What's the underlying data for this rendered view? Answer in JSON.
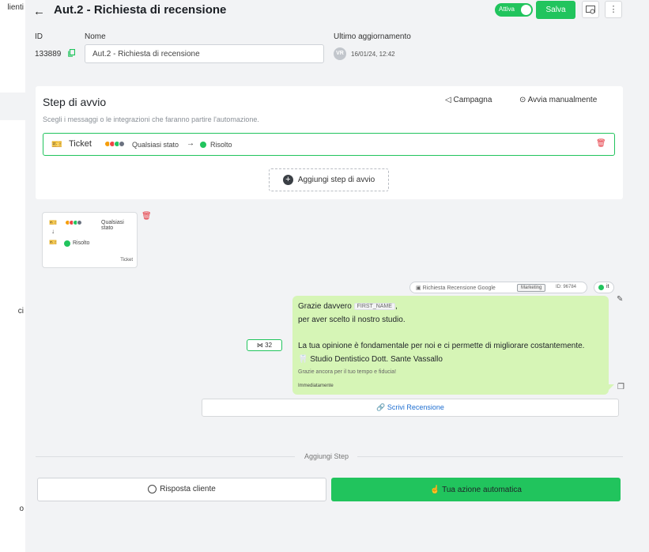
{
  "sidebar_fragments": [
    "lienti",
    "ci",
    "o"
  ],
  "header": {
    "back_icon": "arrow-left-icon",
    "title": "Aut.2 - Richiesta di recensione",
    "toggle_label": "Attiva",
    "toggle_on": true,
    "save_label": "Salva",
    "preview_icon": "preview-settings-icon",
    "more_icon": "more-vertical-icon"
  },
  "meta": {
    "id_label": "ID",
    "id_value": "133889",
    "name_label": "Nome",
    "name_value": "Aut.2 - Richiesta di recensione",
    "updated_label": "Ultimo aggiornamento",
    "updated_avatar": "VR",
    "updated_value": "16/01/24, 12:42"
  },
  "start_steps": {
    "title": "Step di avvio",
    "description": "Scegli i messaggi o le integrazioni che faranno partire l'automazione.",
    "campaign_label": "Campagna",
    "manual_label": "Avvia manualmente",
    "trigger": {
      "name": "Ticket",
      "from_state": "Qualsiasi stato",
      "arrow": "→",
      "to_state": "Risolto"
    },
    "add_label": "Aggiungi step di avvio"
  },
  "flow_node": {
    "from_state": "Qualsiasi stato",
    "to_state": "Risolto",
    "footer": "Ticket"
  },
  "template": {
    "name": "Richiesta Recensione Google",
    "category": "Marketing",
    "id_text": "ID: 96784",
    "language": "it"
  },
  "message": {
    "line1_prefix": "Grazie davvero",
    "variable": "FIRST_NAME",
    "line1_suffix": ",",
    "line2": "per aver scelto il nostro studio.",
    "line3": "La tua opinione è fondamentale per noi e ci permette di migliorare costantemente.",
    "line4": "🦷 Studio Dentistico Dott. Sante Vassallo",
    "signature": "Grazie ancora per il tuo tempo e fiducia!",
    "timing": "Immediatamente"
  },
  "count_chip": "32",
  "review_button": "Scrivi Recensione",
  "add_step": {
    "label": "Aggiungi Step",
    "reply_label": "Risposta cliente",
    "auto_label": "Tua azione automatica"
  },
  "status_colors": [
    "#f59e0b",
    "#ef4444",
    "#22c55e",
    "#6b7280"
  ],
  "accent_color": "#21c45d"
}
